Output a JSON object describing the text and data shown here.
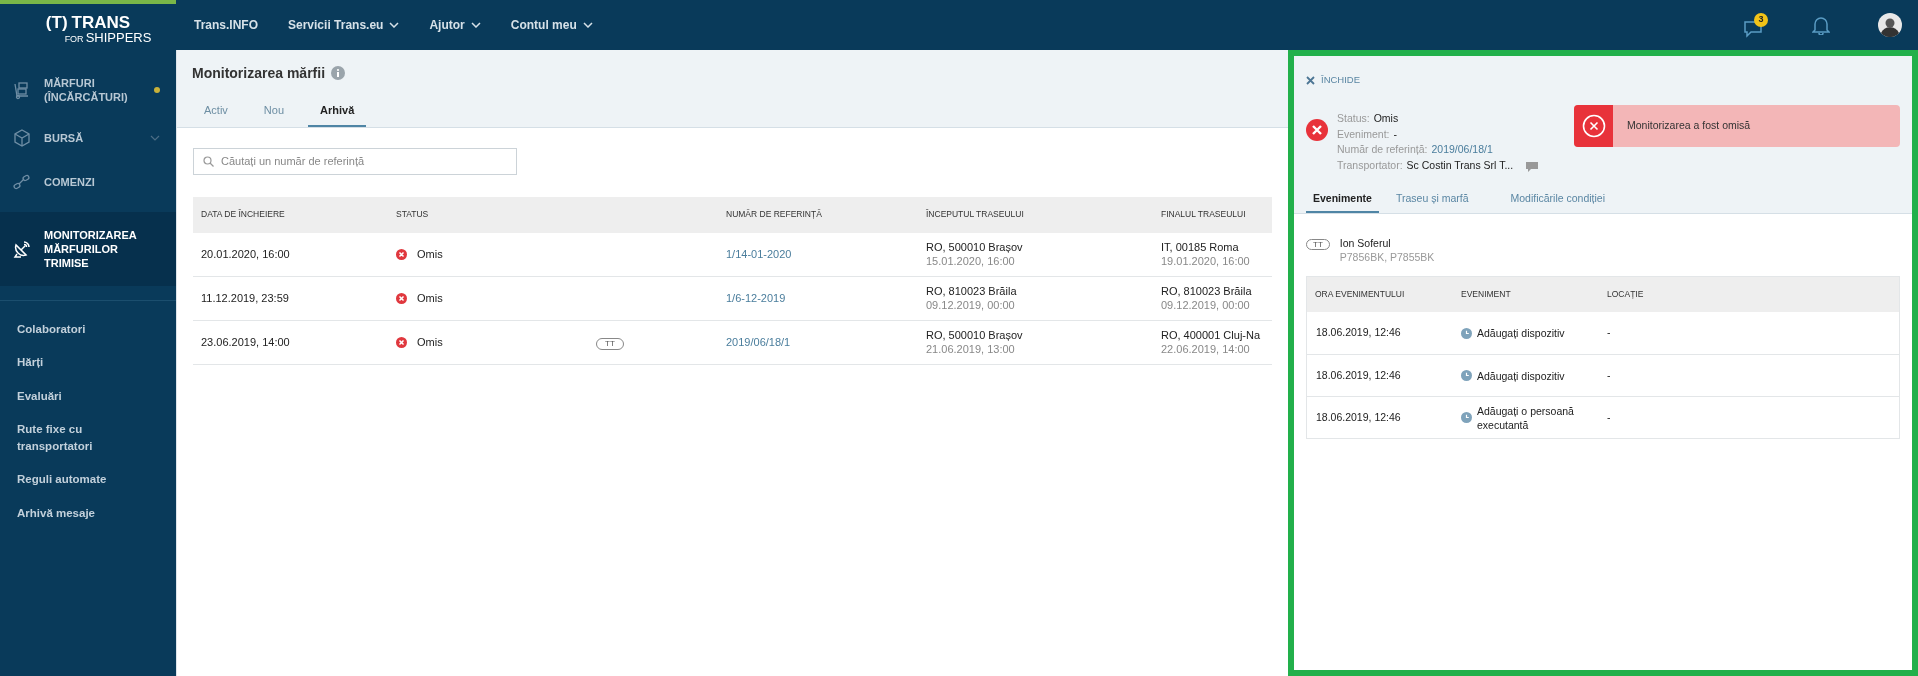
{
  "logo": {
    "mark": "(T)",
    "brand": "TRANS",
    "sub_for": "FOR",
    "sub_name": "SHIPPERS"
  },
  "sidebar": {
    "main_items": [
      {
        "label": "MĂRFURI (ÎNCĂRCĂTURI)",
        "kind": "cargo",
        "selected": false,
        "notification": true,
        "expandable": false
      },
      {
        "label": "BURSĂ",
        "kind": "box",
        "selected": false,
        "expandable": true
      },
      {
        "label": "COMENZI",
        "kind": "orders",
        "selected": false,
        "expandable": false
      },
      {
        "label": "MONITORIZAREA MĂRFURILOR TRIMISE",
        "kind": "satellite",
        "selected": true,
        "expandable": false
      }
    ],
    "links": [
      "Colaboratori",
      "Hărți",
      "Evaluări",
      "Rute fixe cu transportatori",
      "Reguli automate",
      "Arhivă mesaje"
    ]
  },
  "topbar": {
    "menu": [
      {
        "label": "Trans.INFO",
        "dropdown": false
      },
      {
        "label": "Servicii Trans.eu",
        "dropdown": true
      },
      {
        "label": "Ajutor",
        "dropdown": true
      },
      {
        "label": "Contul meu",
        "dropdown": true
      }
    ],
    "messages_badge": "3"
  },
  "page": {
    "title": "Monitorizarea mărfii",
    "tabs": [
      {
        "label": "Activ",
        "selected": false
      },
      {
        "label": "Nou",
        "selected": false
      },
      {
        "label": "Arhivă",
        "selected": true
      }
    ],
    "search": {
      "placeholder": "Căutați un număr de referință"
    },
    "table": {
      "columns": [
        "DATA DE ÎNCHEIERE",
        "STATUS",
        "",
        "NUMĂR DE REFERINȚĂ",
        "ÎNCEPUTUL TRASEULUI",
        "FINALUL TRASEULUI"
      ],
      "rows": [
        {
          "end_date": "20.01.2020, 16:00",
          "status": "Omis",
          "badge": "",
          "reference": "1/14-01-2020",
          "start_place": "RO, 500010 Brașov",
          "start_date": "15.01.2020, 16:00",
          "end_place": "IT, 00185 Roma",
          "end_place_date": "19.01.2020, 16:00"
        },
        {
          "end_date": "11.12.2019, 23:59",
          "status": "Omis",
          "badge": "",
          "reference": "1/6-12-2019",
          "start_place": "RO, 810023 Brăila",
          "start_date": "09.12.2019, 00:00",
          "end_place": "RO, 810023 Brăila",
          "end_place_date": "09.12.2019, 00:00"
        },
        {
          "end_date": "23.06.2019, 14:00",
          "status": "Omis",
          "badge": "TT",
          "reference": "2019/06/18/1",
          "start_place": "RO, 500010 Brașov",
          "start_date": "21.06.2019, 13:00",
          "end_place": "RO, 400001 Cluj-Na",
          "end_place_date": "22.06.2019, 14:00"
        }
      ]
    }
  },
  "detail_panel": {
    "close_label": "ÎNCHIDE",
    "fields": [
      {
        "label": "Status:",
        "value": "Omis",
        "kind": "plain"
      },
      {
        "label": "Eveniment:",
        "value": "-",
        "kind": "plain"
      },
      {
        "label": "Număr de referință:",
        "value": "2019/06/18/1",
        "kind": "link"
      },
      {
        "label": "Transportator:",
        "value": "Sc Costin Trans Srl T...",
        "kind": "carrier"
      }
    ],
    "alert": "Monitorizarea a fost omisă",
    "tabs": [
      {
        "label": "Evenimente",
        "selected": true
      },
      {
        "label": "Traseu și marfă",
        "selected": false
      },
      {
        "label": "Modificările condiției",
        "selected": false
      }
    ],
    "driver": {
      "badge": "TT",
      "name": "Ion Soferul",
      "plates": "P7856BK, P7855BK"
    },
    "events": {
      "columns": [
        "ORA EVENIMENTULUI",
        "EVENIMENT",
        "LOCAȚIE"
      ],
      "rows": [
        {
          "time": "18.06.2019, 12:46",
          "event": "Adăugați dispozitiv",
          "location": "-"
        },
        {
          "time": "18.06.2019, 12:46",
          "event": "Adăugați dispozitiv",
          "location": "-"
        },
        {
          "time": "18.06.2019, 12:46",
          "event": "Adăugați o persoană executantă",
          "location": "-"
        }
      ]
    }
  }
}
